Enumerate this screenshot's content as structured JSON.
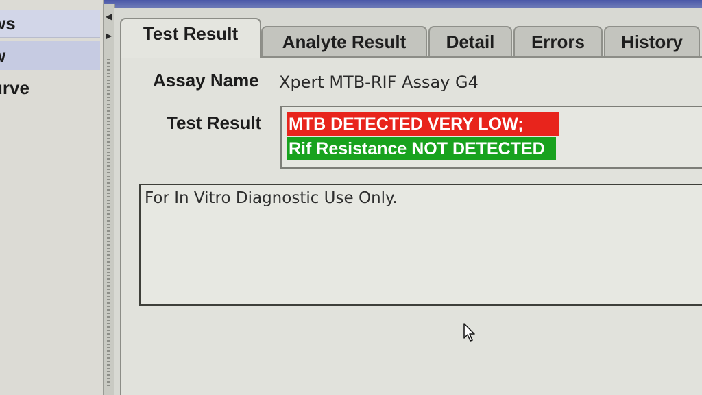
{
  "left_panel": {
    "items": [
      {
        "label": "ws"
      },
      {
        "label": "w"
      },
      {
        "label": "urve"
      }
    ]
  },
  "splitter": {
    "left_arrow_icon": "triangle-left-icon",
    "right_arrow_icon": "triangle-right-icon"
  },
  "tabs": [
    {
      "label": "Test Result",
      "active": true
    },
    {
      "label": "Analyte Result",
      "active": false
    },
    {
      "label": "Detail",
      "active": false
    },
    {
      "label": "Errors",
      "active": false
    },
    {
      "label": "History",
      "active": false
    }
  ],
  "test_result": {
    "assay_name_label": "Assay Name",
    "assay_name_value": "Xpert MTB-RIF Assay G4",
    "test_result_label": "Test Result",
    "result_lines": [
      {
        "text": "MTB DETECTED VERY LOW;",
        "color": "#e8241c"
      },
      {
        "text": "Rif Resistance NOT DETECTED",
        "color": "#18a21e"
      }
    ],
    "notes": "For In Vitro Diagnostic Use Only."
  },
  "colors": {
    "detected_red": "#e8241c",
    "not_detected_green": "#18a21e"
  },
  "cursor_icon": "mouse-pointer-icon"
}
